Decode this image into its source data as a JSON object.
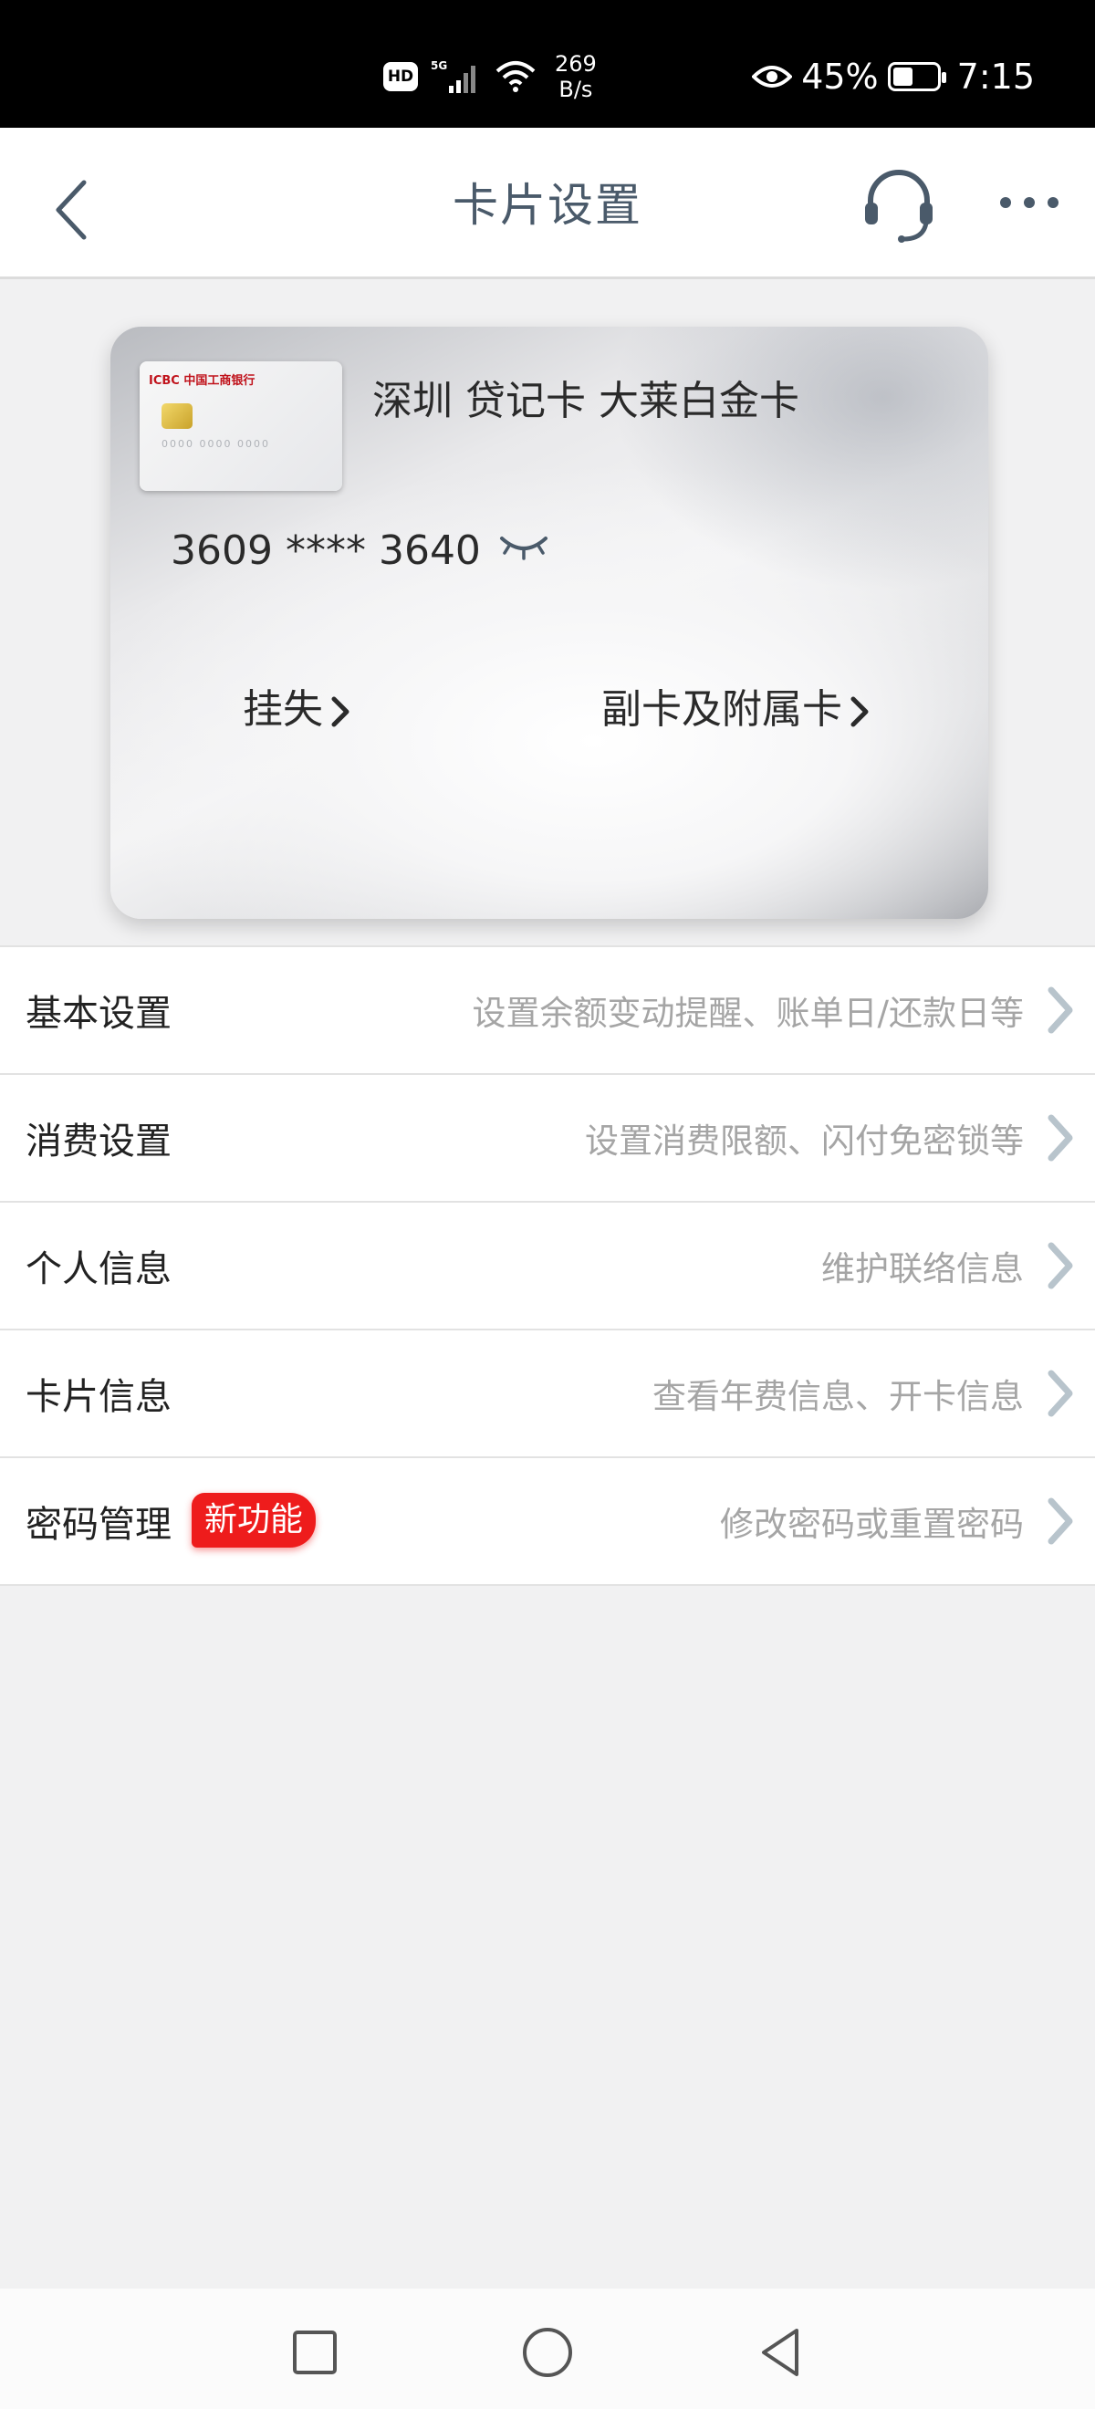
{
  "status_bar": {
    "hd": "HD",
    "network": "5G",
    "speed_value": "269",
    "speed_unit": "B/s",
    "battery_percent": "45%",
    "battery_level": 0.45,
    "time": "7:15"
  },
  "nav": {
    "title": "卡片设置",
    "back_icon": "chevron-left-icon",
    "service_icon": "headset-icon",
    "more_icon": "more-dots-icon"
  },
  "card": {
    "name": "深圳 贷记卡 大莱白金卡",
    "number": "3609 **** 3640",
    "thumb_brand": "ICBC 中国工商银行",
    "lost_label": "挂失",
    "supplementary_label": "副卡及附属卡"
  },
  "settings": [
    {
      "title": "基本设置",
      "desc": "设置余额变动提醒、账单日/还款日等"
    },
    {
      "title": "消费设置",
      "desc": "设置消费限额、闪付免密锁等"
    },
    {
      "title": "个人信息",
      "desc": "维护联络信息"
    },
    {
      "title": "卡片信息",
      "desc": "查看年费信息、开卡信息"
    },
    {
      "title": "密码管理",
      "desc": "修改密码或重置密码",
      "badge": "新功能"
    }
  ],
  "colors": {
    "accent_text": "#4a5a6a",
    "chevron": "#b8c4cc",
    "badge": "#ee1c1c"
  }
}
